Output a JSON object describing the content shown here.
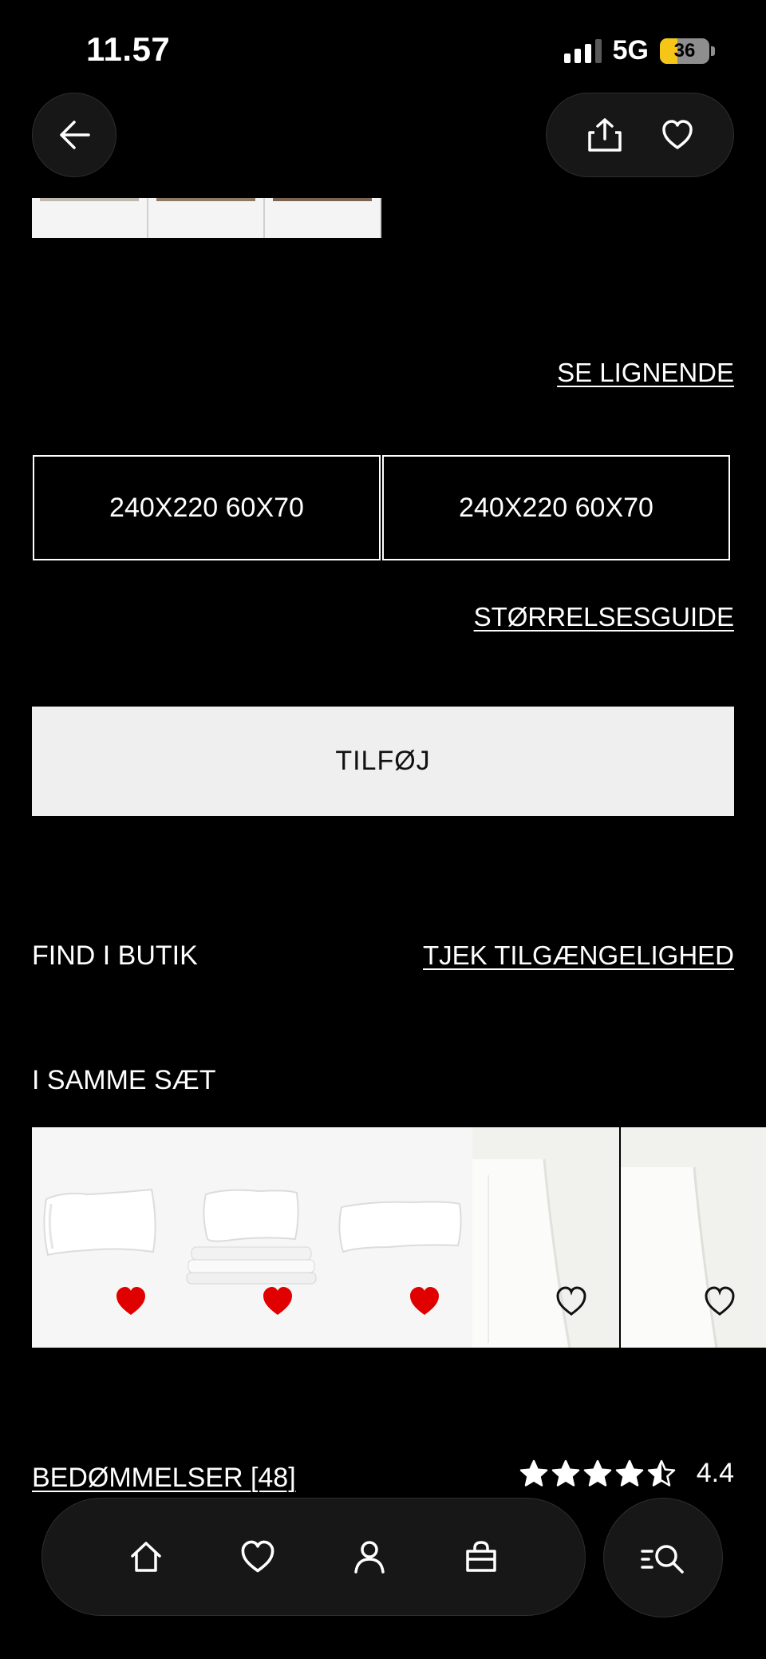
{
  "status_bar": {
    "time": "11.57",
    "network": "5G",
    "battery": "36",
    "battery_level": 0.36
  },
  "header": {
    "back_icon": "arrow-left-icon",
    "share_icon": "share-icon",
    "favorite_icon": "heart-outline-icon"
  },
  "gallery": {
    "thumbnail_count": 3
  },
  "links": {
    "see_similar": "SE LIGNENDE",
    "size_guide": "STØRRELSESGUIDE",
    "check_availability": "TJEK TILGÆNGELIGHED",
    "reviews": "BEDØMMELSER [48]"
  },
  "sizes": [
    {
      "label": "240X220 60X70"
    },
    {
      "label": "240X220 60X70"
    }
  ],
  "add_button": "TILFØJ",
  "find_in_store": "FIND I BUTIK",
  "same_set": {
    "title": "I SAMME SÆT",
    "items": [
      {
        "image": "pillow-image",
        "favorited": true
      },
      {
        "image": "duvet-and-pillow-image",
        "favorited": true
      },
      {
        "image": "pillow-image",
        "favorited": true
      },
      {
        "image": "valance-sheet-image",
        "favorited": false
      },
      {
        "image": "valance-sheet-image",
        "favorited": false
      }
    ]
  },
  "rating": {
    "value": "4.4",
    "stars": 4.4,
    "max": 5
  },
  "bottom_nav": {
    "items": [
      "home-icon",
      "heart-icon",
      "account-icon",
      "bag-icon"
    ],
    "search": "search-menu-icon"
  },
  "colors": {
    "accent": "#e00000",
    "background": "#000000",
    "button": "#efefef"
  }
}
